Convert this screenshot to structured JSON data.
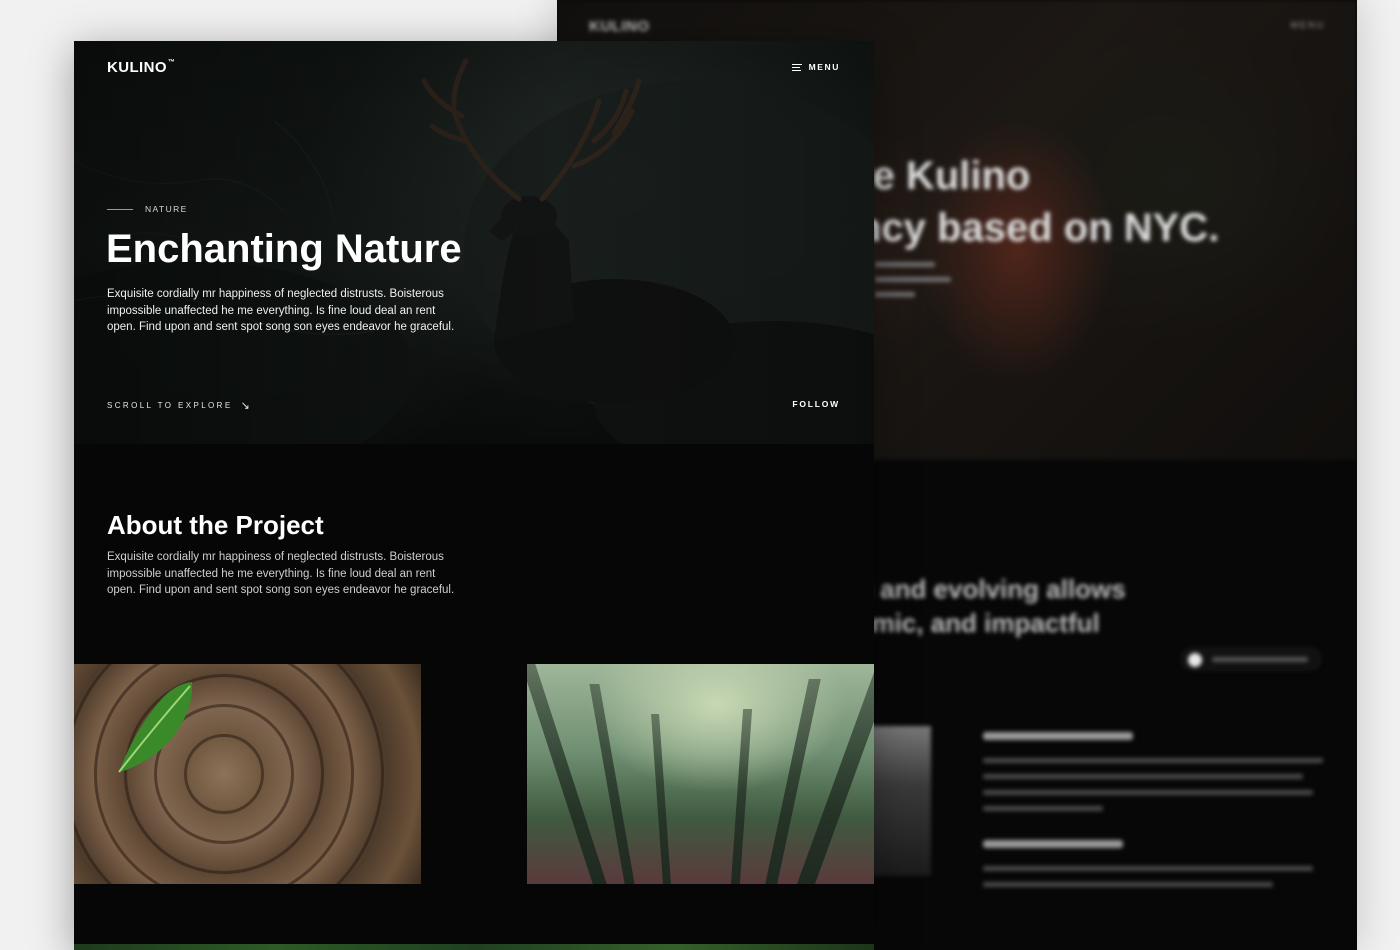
{
  "back_page": {
    "logo": "KULINO",
    "menu_label": "MENU",
    "headline_line1": "re Kulino",
    "headline_line2": "ncy based on NYC.",
    "section_line1": "g and evolving allows",
    "section_line2": "amic, and impactful"
  },
  "front_page": {
    "header": {
      "logo": "KULINO",
      "logo_mark": "™",
      "menu_label": "MENU"
    },
    "hero": {
      "eyebrow": "NATURE",
      "title": "Enchanting Nature",
      "description": "Exquisite cordially mr happiness of neglected distrusts. Boisterous impossible unaffected he me everything. Is fine loud deal an rent open. Find upon and sent spot song son eyes endeavor he graceful.",
      "scroll_label": "SCROLL TO EXPLORE",
      "scroll_arrow": "↘",
      "follow_label": "FOLLOW"
    },
    "about": {
      "title": "About the Project",
      "description": "Exquisite cordially mr happiness of neglected distrusts. Boisterous impossible unaffected he me everything. Is fine loud deal an rent open. Find upon and sent spot song son eyes endeavor he graceful."
    }
  }
}
